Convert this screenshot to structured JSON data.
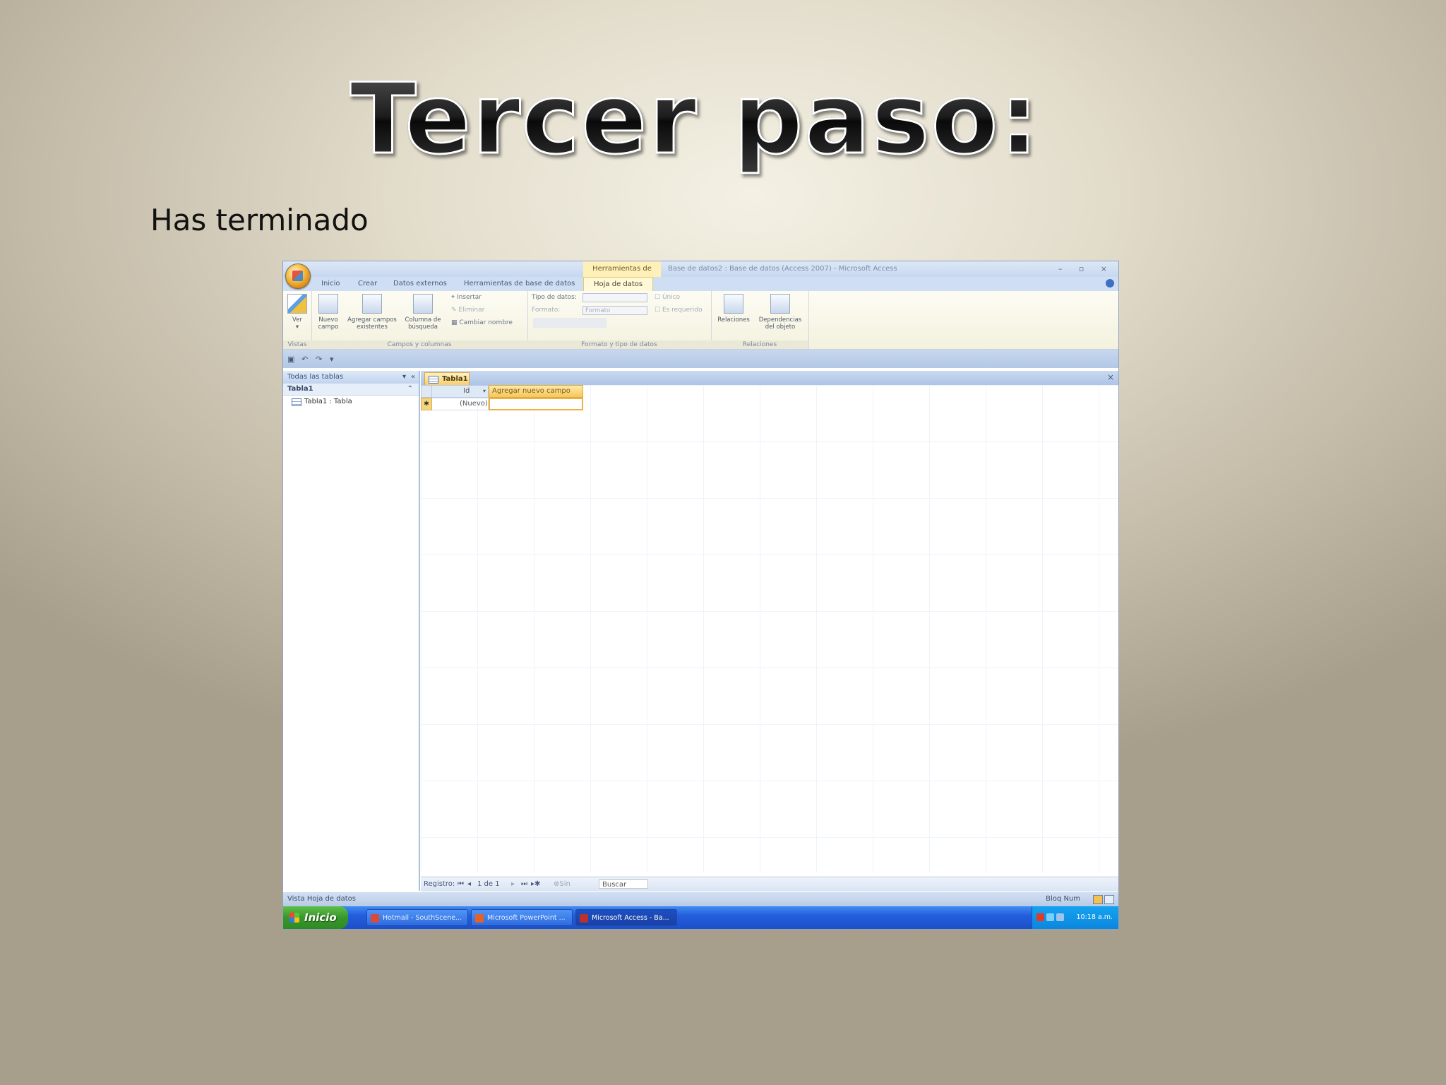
{
  "slide": {
    "title": "Tercer paso:",
    "subtitle": "Has terminado"
  },
  "window": {
    "context_tab_group": "Herramientas de tabla",
    "title": "Base de datos2 : Base de datos (Access 2007) - Microsoft Access",
    "controls": "– ▫ ×"
  },
  "ribbon": {
    "tabs": [
      "Inicio",
      "Crear",
      "Datos externos",
      "Herramientas de base de datos",
      "Hoja de datos"
    ],
    "groups": {
      "vistas": {
        "label": "Vistas",
        "ver": "Ver"
      },
      "campos": {
        "label": "Campos y columnas",
        "nuevo_campo": "Nuevo campo",
        "agregar_existentes": "Agregar campos existentes",
        "columna_busqueda": "Columna de búsqueda",
        "insertar": "Insertar",
        "eliminar": "Eliminar",
        "cambiar_nombre": "Cambiar nombre"
      },
      "formato": {
        "label": "Formato y tipo de datos",
        "tipo_datos": "Tipo de datos:",
        "formato": "Formato:",
        "formato_value": "Formato",
        "unico": "Único",
        "es_requerido": "Es requerido"
      },
      "relaciones": {
        "label": "Relaciones",
        "relaciones_btn": "Relaciones",
        "dependencias": "Dependencias del objeto"
      }
    }
  },
  "nav_pane": {
    "header": "Todas las tablas",
    "group": "Tabla1",
    "item": "Tabla1 : Tabla"
  },
  "document": {
    "tab": "Tabla1",
    "columns": {
      "id": "Id",
      "add_field": "Agregar nuevo campo"
    },
    "new_row": {
      "marker": "✱",
      "id_value": "(Nuevo)"
    },
    "record_nav": {
      "label": "Registro:",
      "position": "1 de 1",
      "filter": "Sin filtro",
      "search": "Buscar"
    }
  },
  "statusbar": {
    "left": "Vista Hoja de datos",
    "right": "Bloq Num"
  },
  "taskbar": {
    "start": "Inicio",
    "items": [
      {
        "label": "Hotmail - SouthScene...",
        "color": "#d94a3a"
      },
      {
        "label": "Microsoft PowerPoint ...",
        "color": "#e2622a"
      },
      {
        "label": "Microsoft Access - Ba...",
        "color": "#b8322c"
      }
    ],
    "clock": "10:18 a.m."
  }
}
